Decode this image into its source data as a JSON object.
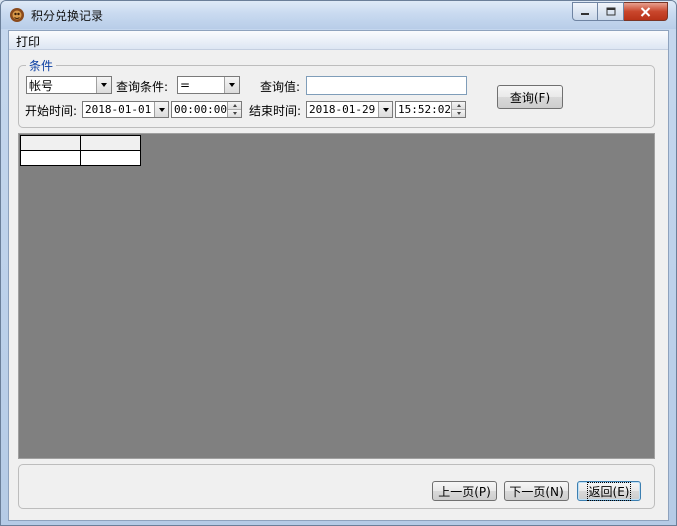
{
  "window": {
    "title": "积分兑换记录"
  },
  "menu": {
    "items": [
      "打印"
    ]
  },
  "condition_group": {
    "title": "条件",
    "field_select": "帐号",
    "query_condition_label": "查询条件:",
    "query_condition_value": "=",
    "query_value_label": "查询值:",
    "query_value": "",
    "start_label": "开始时间:",
    "start_date": "2018-01-01",
    "start_time": "00:00:00",
    "end_label": "结束时间:",
    "end_date": "2018-01-29",
    "end_time": "15:52:02",
    "query_button": "查询(F)"
  },
  "grid": {
    "header": [
      "",
      ""
    ],
    "rows": [
      [
        "",
        ""
      ]
    ]
  },
  "footer": {
    "prev_button": "上一页(P)",
    "next_button": "下一页(N)",
    "back_button": "返回(E)"
  },
  "colors": {
    "title_bar": "#c9daf0",
    "close_button": "#c9462c",
    "grid_background": "#808080",
    "group_title": "#0b3fa3"
  }
}
